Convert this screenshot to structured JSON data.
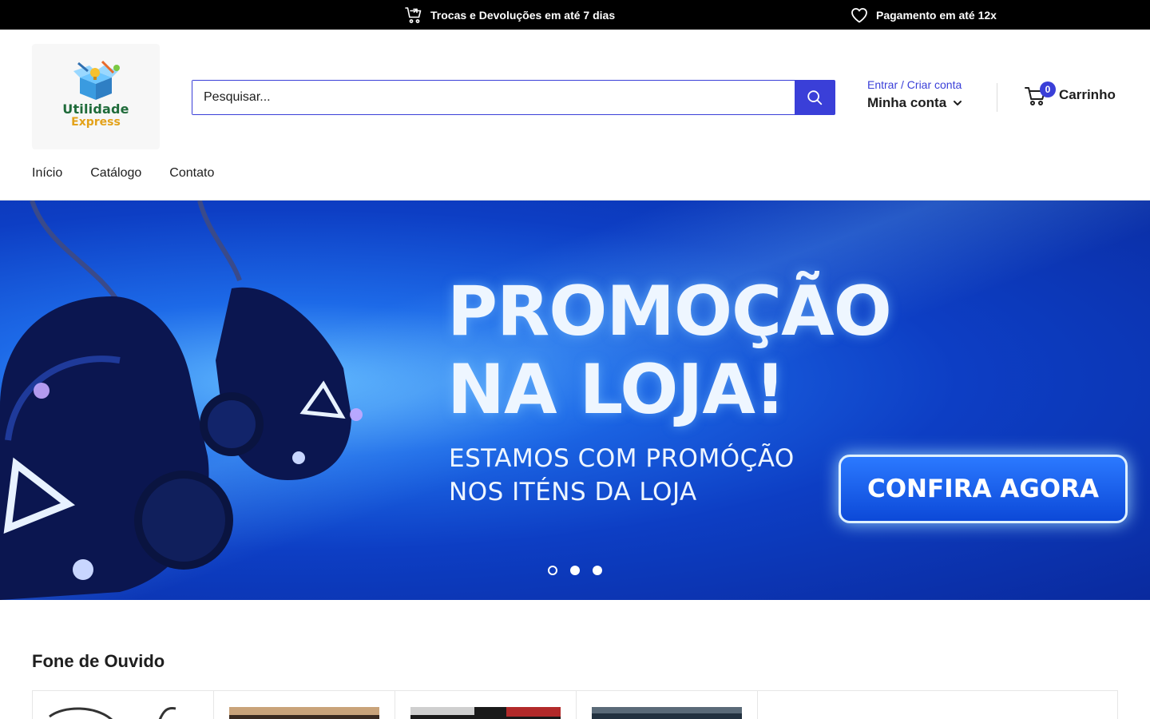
{
  "announcement": {
    "items": [
      {
        "icon": "cart-return-icon",
        "text": "Trocas e Devoluções em até 7 dias"
      },
      {
        "icon": "heart-icon",
        "text": "Pagamento em até 12x"
      }
    ]
  },
  "logo": {
    "line1": "Utilidade",
    "line2": "Express"
  },
  "search": {
    "placeholder": "Pesquisar..."
  },
  "account": {
    "login_link": "Entrar / Criar conta",
    "label": "Minha conta"
  },
  "cart": {
    "count": "0",
    "label": "Carrinho"
  },
  "nav": {
    "items": [
      "Início",
      "Catálogo",
      "Contato"
    ]
  },
  "hero": {
    "title_line1": "PROMOÇÃO",
    "title_line2": "NA LOJA!",
    "sub_line1": "ESTAMOS COM PROMÓÇÃO",
    "sub_line2": "NOS ITÉNS DA LOJA",
    "cta": "CONFIRA AGORA",
    "slides": 3,
    "active_slide": 1
  },
  "section": {
    "title": "Fone de Ouvido"
  },
  "colors": {
    "accent": "#3a3fd8",
    "topbar": "#000000",
    "text": "#1e1e1e"
  }
}
